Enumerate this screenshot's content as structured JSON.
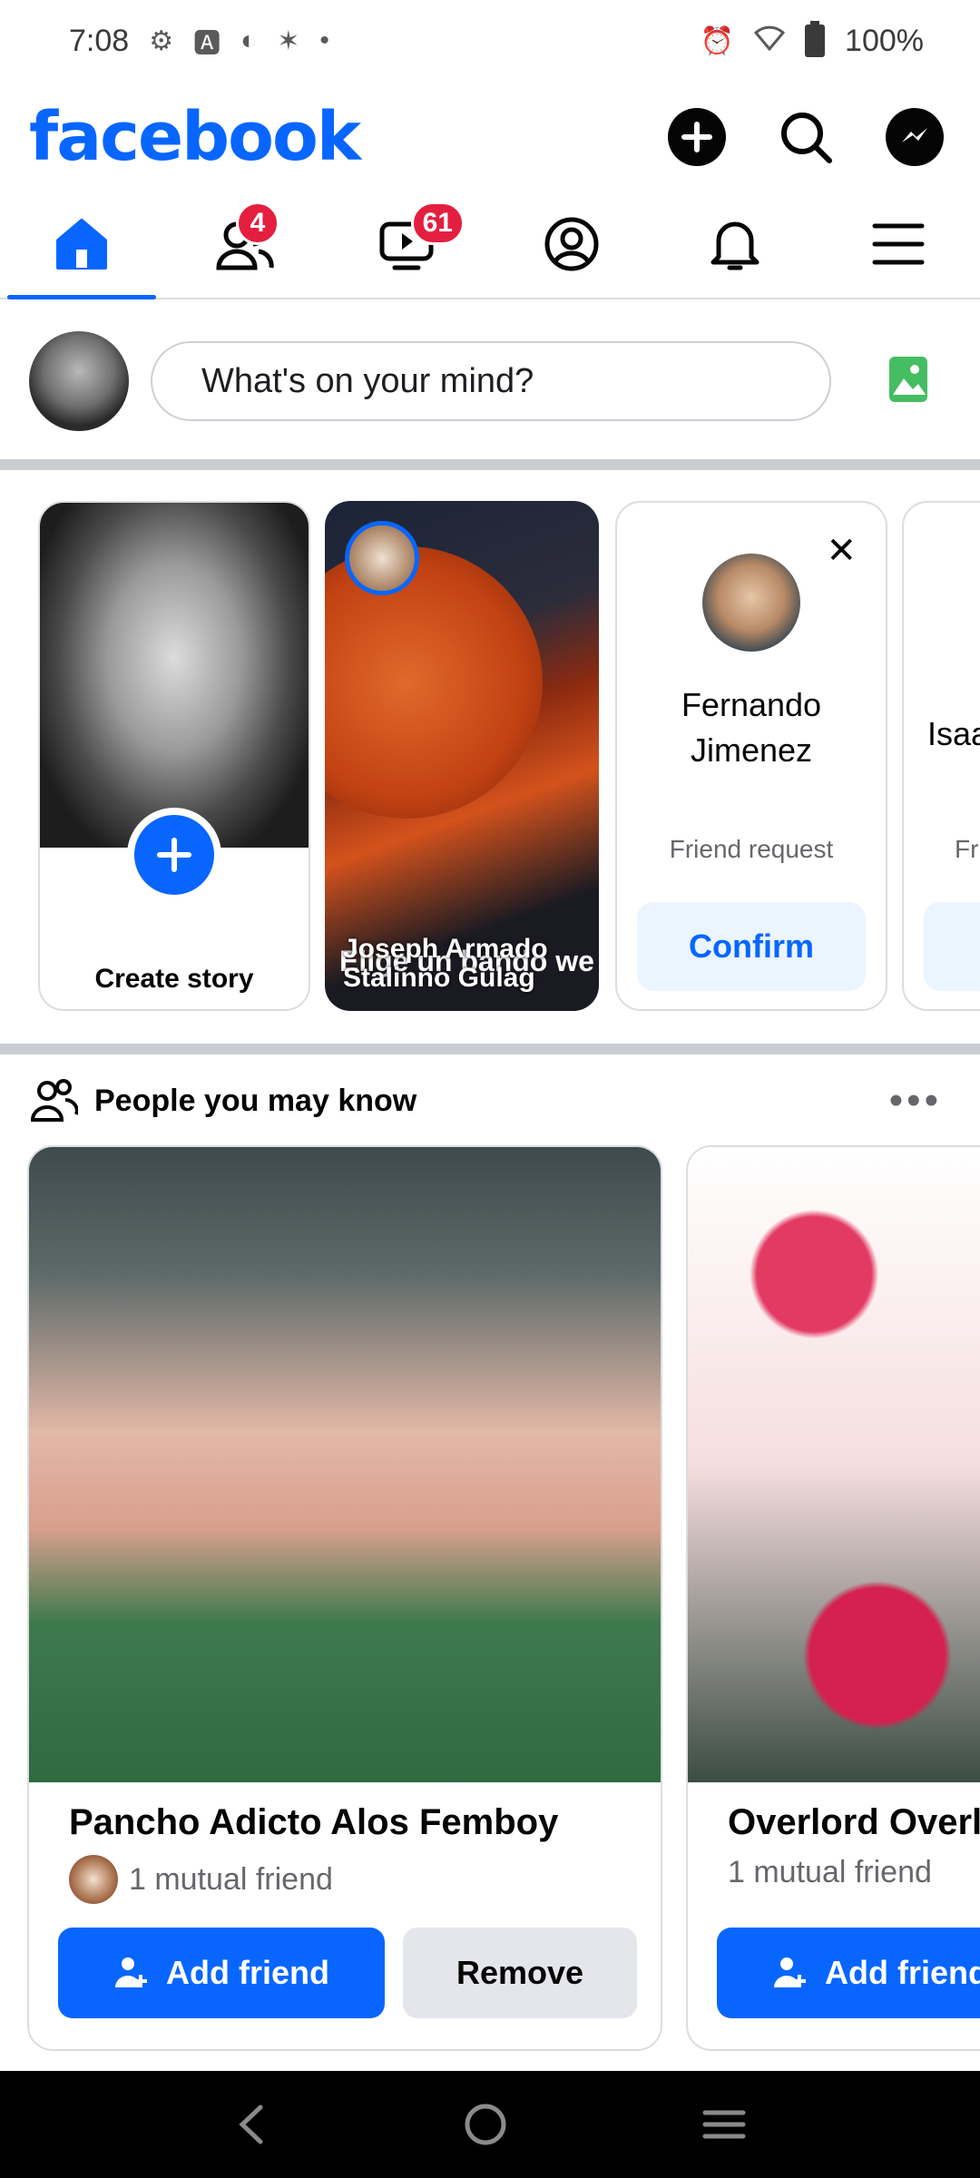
{
  "status_bar": {
    "time": "7:08",
    "battery": "100%"
  },
  "header": {
    "logo": "facebook"
  },
  "nav": {
    "friends_badge": "4",
    "video_badge": "61"
  },
  "composer": {
    "placeholder": "What's on your mind?"
  },
  "stories": {
    "create_label": "Create story",
    "user_story_author": "Joseph Armado Stalinno Gulag",
    "user_story_overlay": "Elige un bando we",
    "requests": [
      {
        "name": "Fernando Jimenez",
        "subtitle": "Friend request",
        "confirm": "Confirm"
      },
      {
        "name": "Isaa",
        "subtitle": "Fr"
      }
    ]
  },
  "pymk": {
    "title": "People you may know",
    "cards": [
      {
        "name": "Pancho Adicto Alos Femboy",
        "mutual": "1 mutual friend",
        "add": "Add friend",
        "remove": "Remove"
      },
      {
        "name": "Overlord Overlo",
        "mutual": "1 mutual friend",
        "add": "Add friend"
      }
    ]
  },
  "colors": {
    "brand": "#0866ff",
    "badge": "#e41e3f"
  }
}
